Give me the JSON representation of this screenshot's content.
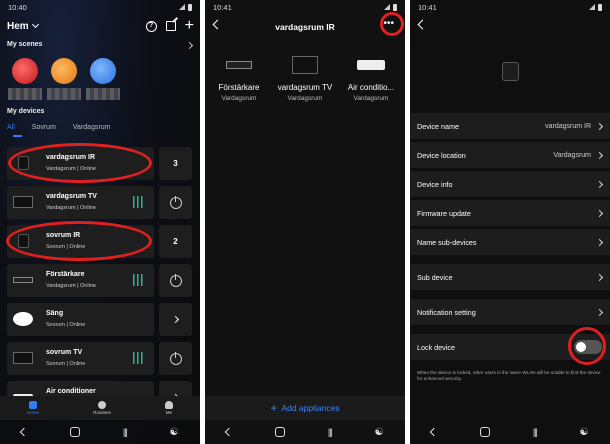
{
  "panel1": {
    "status_time": "10:40",
    "home_title": "Hem",
    "scenes_label": "My scenes",
    "devices_label": "My devices",
    "tabs": [
      "All",
      "Sovrum",
      "Vardagsrum"
    ],
    "devices": [
      {
        "name": "vardagsrum IR",
        "sub": "Vardagsrum | Online",
        "side": "3"
      },
      {
        "name": "vardagsrum TV",
        "sub": "Vardagsrum | Online",
        "side": "power"
      },
      {
        "name": "sovrum IR",
        "sub": "Sovrum | Online",
        "side": "2"
      },
      {
        "name": "Förstärkare",
        "sub": "Vardagsrum | Online",
        "side": "power"
      },
      {
        "name": "Säng",
        "sub": "Sovrum | Online",
        "side": "arrow"
      },
      {
        "name": "sovrum TV",
        "sub": "Sovrum | Online",
        "side": "power"
      },
      {
        "name": "Air conditioner",
        "sub": "",
        "side": "arrow"
      }
    ],
    "nav": [
      "Home",
      "Routines",
      "Me"
    ]
  },
  "panel2": {
    "status_time": "10:41",
    "title": "vardagsrum IR",
    "appliances": [
      {
        "name": "Förstärkare",
        "room": "Vardagsrum"
      },
      {
        "name": "vardagsrum TV",
        "room": "Vardagsrum"
      },
      {
        "name": "Air conditio...",
        "room": "Vardagsrum"
      }
    ],
    "add_label": "Add appliances"
  },
  "panel3": {
    "status_time": "10:41",
    "settings": [
      {
        "label": "Device name",
        "value": "vardagsrum IR"
      },
      {
        "label": "Device location",
        "value": "Vardagsrum"
      },
      {
        "label": "Device info",
        "value": ""
      },
      {
        "label": "Firmware update",
        "value": ""
      },
      {
        "label": "Name sub-devices",
        "value": ""
      },
      {
        "label": "Sub device",
        "value": ""
      },
      {
        "label": "Notification setting",
        "value": ""
      },
      {
        "label": "Lock device",
        "value": ""
      }
    ],
    "lock_note": "When the device is locked, other users in the same WLAN will be unable to find the device for enhanced security."
  },
  "colors": {
    "accent": "#2f7df6",
    "annotation": "#e02020",
    "slider": "#2bb39a"
  }
}
